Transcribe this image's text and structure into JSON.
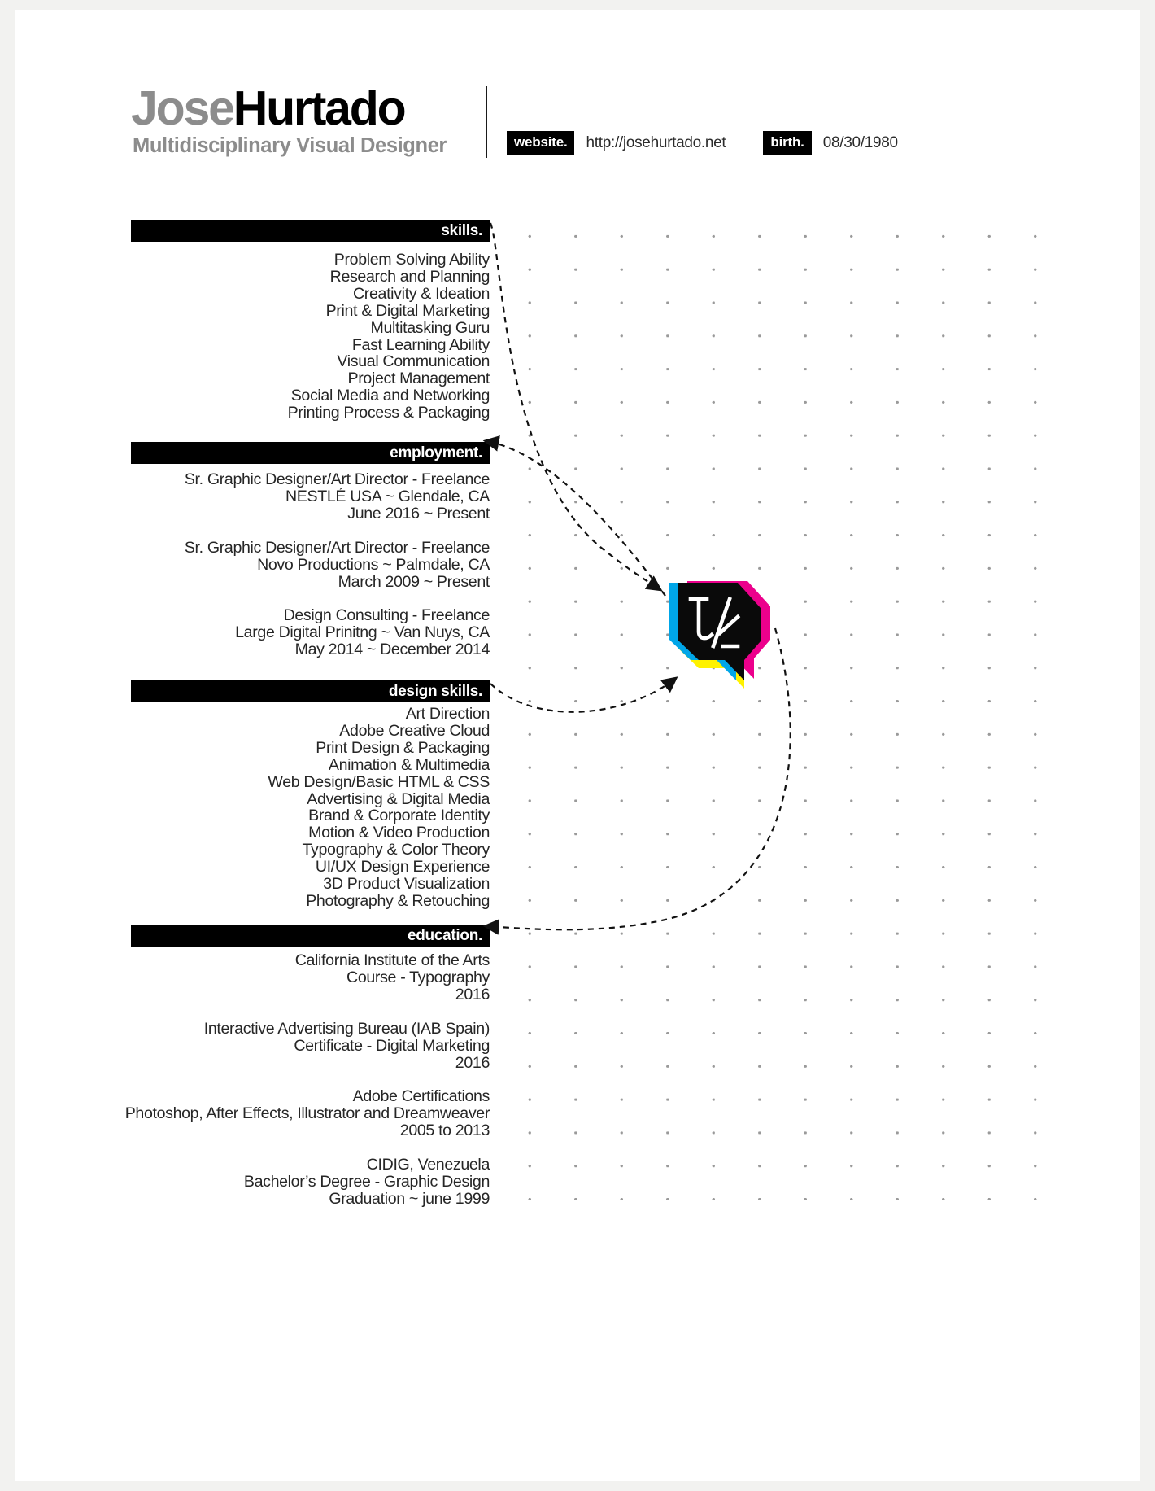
{
  "header": {
    "first_name": "Jose",
    "last_name": "Hurtado",
    "subtitle": "Multidisciplinary Visual Designer",
    "website_label": "website.",
    "website_value": "http://josehurtado.net",
    "birth_label": "birth.",
    "birth_value": "08/30/1980"
  },
  "colors": {
    "page_background": "#ffffff",
    "canvas_background": "#f2f2f0",
    "bar_background": "#000000",
    "bar_text": "#ffffff",
    "name_first": "#8c8c8c",
    "name_last": "#000000",
    "body_text": "#262626",
    "dot_grid": "#9a9a9a",
    "logo_cyan": "#00a6e8",
    "logo_magenta": "#ec008c",
    "logo_yellow": "#fff200",
    "logo_black": "#000000"
  },
  "sections": [
    {
      "id": "skills",
      "title": "skills.",
      "items": [
        "Problem Solving Ability",
        "Research and Planning",
        "Creativity & Ideation",
        "Print & Digital Marketing",
        "Multitasking Guru",
        "Fast Learning Ability",
        "Visual Communication",
        "Project Management",
        "Social Media and Networking",
        "Printing Process & Packaging"
      ]
    },
    {
      "id": "employment",
      "title": "employment.",
      "entries": [
        [
          "Sr. Graphic Designer/Art Director - Freelance",
          "NESTLÉ USA ~ Glendale, CA",
          "June 2016 ~ Present"
        ],
        [
          "Sr. Graphic Designer/Art Director - Freelance",
          "Novo Productions ~ Palmdale, CA",
          "March 2009 ~ Present"
        ],
        [
          "Design Consulting - Freelance",
          "Large Digital Prinitng ~ Van Nuys, CA",
          "May 2014 ~ December 2014"
        ]
      ]
    },
    {
      "id": "design-skills",
      "title": "design skills.",
      "items": [
        "Art Direction",
        "Adobe Creative Cloud",
        "Print Design & Packaging",
        "Animation & Multimedia",
        "Web Design/Basic HTML & CSS",
        "Advertising & Digital Media",
        "Brand & Corporate Identity",
        "Motion & Video Production",
        "Typography & Color Theory",
        "UI/UX Design Experience",
        "3D Product Visualization",
        "Photography & Retouching"
      ]
    },
    {
      "id": "education",
      "title": "education.",
      "entries": [
        [
          "California Institute of the Arts",
          "Course - Typography",
          "2016"
        ],
        [
          "Interactive Advertising Bureau (IAB Spain)",
          "Certificate - Digital Marketing",
          "2016"
        ],
        [
          "Adobe Certifications",
          "Photoshop, After Effects, Illustrator and Dreamweaver",
          "2005 to 2013"
        ],
        [
          "CIDIG, Venezuela",
          "Bachelor’s Degree - Graphic Design",
          "Graduation ~ june 1999"
        ]
      ]
    }
  ],
  "logo": {
    "name": "jh-monogram-speech-bubble-logo",
    "monogram": "JH"
  }
}
